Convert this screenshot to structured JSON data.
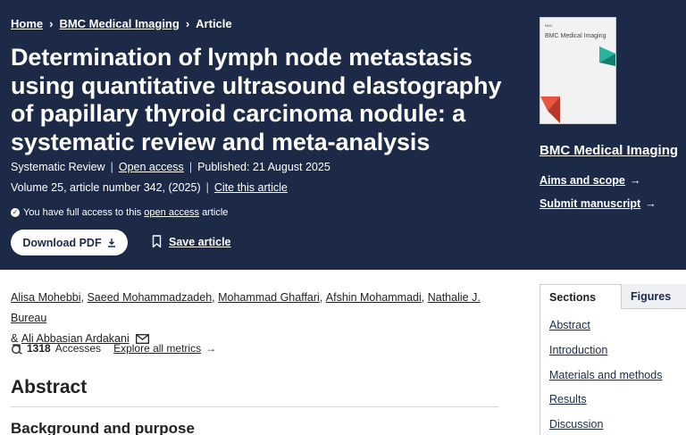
{
  "breadcrumb": {
    "home": "Home",
    "journal": "BMC Medical Imaging",
    "current": "Article"
  },
  "article": {
    "title": "Determination of lymph node metastasis using quantitative ultrasound elastography of papillary thyroid carcinoma nodule: a systematic review and meta-analysis",
    "type": "Systematic Review",
    "open_access": "Open access",
    "published": "Published: 21 August 2025",
    "volume": "Volume 25, article number 342, (2025)",
    "cite": "Cite this article",
    "access_note_pre": "You have full access to this",
    "access_note_link": "open access",
    "access_note_post": "article",
    "download_label": "Download PDF",
    "save_label": "Save article"
  },
  "journal": {
    "cover_brand": "BMC",
    "cover_title": "BMC Medical Imaging",
    "name": "BMC Medical Imaging",
    "aims": "Aims and scope",
    "submit": "Submit manuscript"
  },
  "authors": [
    "Alisa Mohebbi",
    "Saeed Mohammadzadeh",
    "Mohammad Ghaffari",
    "Afshin Mohammadi",
    "Nathalie J. Bureau",
    "Ali Abbasian Ardakani"
  ],
  "metrics": {
    "count": "1318",
    "label": "Accesses",
    "explore": "Explore all metrics"
  },
  "abstract": {
    "heading": "Abstract",
    "subheading": "Background and purpose"
  },
  "sidebar": {
    "tabs": [
      "Sections",
      "Figures"
    ],
    "sections": [
      "Abstract",
      "Introduction",
      "Materials and methods",
      "Results",
      "Discussion"
    ]
  },
  "colors": {
    "hero_bg": "#1c2a48",
    "link": "#1c2a48",
    "accent_teal": "#22b5a0",
    "accent_red": "#e8563f"
  }
}
